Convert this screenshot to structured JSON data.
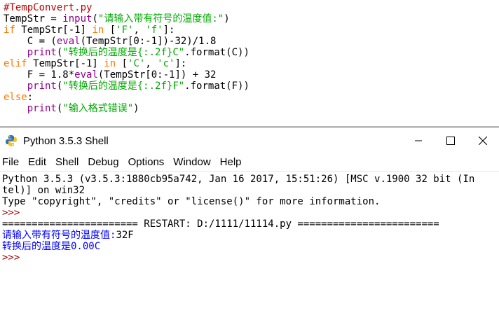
{
  "colors": {
    "comment": "#c00000",
    "keyword": "#ff7700",
    "builtin": "#900090",
    "string": "#00aa00",
    "default": "#000000",
    "stdout": "#0000ff",
    "prompt": "#990000"
  },
  "editor": {
    "lines": [
      [
        {
          "t": "#TempConvert.py",
          "c": "comment"
        }
      ],
      [
        {
          "t": "TempStr = ",
          "c": "default"
        },
        {
          "t": "input",
          "c": "builtin"
        },
        {
          "t": "(",
          "c": "default"
        },
        {
          "t": "\"请输入带有符号的温度值:\"",
          "c": "string"
        },
        {
          "t": ")",
          "c": "default"
        }
      ],
      [
        {
          "t": "if",
          "c": "keyword"
        },
        {
          "t": " TempStr[-1] ",
          "c": "default"
        },
        {
          "t": "in",
          "c": "keyword"
        },
        {
          "t": " [",
          "c": "default"
        },
        {
          "t": "'F'",
          "c": "string"
        },
        {
          "t": ", ",
          "c": "default"
        },
        {
          "t": "'f'",
          "c": "string"
        },
        {
          "t": "]:",
          "c": "default"
        }
      ],
      [
        {
          "t": "    C = (",
          "c": "default"
        },
        {
          "t": "eval",
          "c": "builtin"
        },
        {
          "t": "(TempStr[0:-1])-32)/1.8",
          "c": "default"
        }
      ],
      [
        {
          "t": "    ",
          "c": "default"
        },
        {
          "t": "print",
          "c": "builtin"
        },
        {
          "t": "(",
          "c": "default"
        },
        {
          "t": "\"转换后的温度是{:.2f}C\"",
          "c": "string"
        },
        {
          "t": ".format(C))",
          "c": "default"
        }
      ],
      [
        {
          "t": "elif",
          "c": "keyword"
        },
        {
          "t": " TempStr[-1] ",
          "c": "default"
        },
        {
          "t": "in",
          "c": "keyword"
        },
        {
          "t": " [",
          "c": "default"
        },
        {
          "t": "'C'",
          "c": "string"
        },
        {
          "t": ", ",
          "c": "default"
        },
        {
          "t": "'c'",
          "c": "string"
        },
        {
          "t": "]:",
          "c": "default"
        }
      ],
      [
        {
          "t": "    F = 1.8*",
          "c": "default"
        },
        {
          "t": "eval",
          "c": "builtin"
        },
        {
          "t": "(TempStr[0:-1]) + 32",
          "c": "default"
        }
      ],
      [
        {
          "t": "    ",
          "c": "default"
        },
        {
          "t": "print",
          "c": "builtin"
        },
        {
          "t": "(",
          "c": "default"
        },
        {
          "t": "\"转换后的温度是{:.2f}F\"",
          "c": "string"
        },
        {
          "t": ".format(F))",
          "c": "default"
        }
      ],
      [
        {
          "t": "else",
          "c": "keyword"
        },
        {
          "t": ":",
          "c": "default"
        }
      ],
      [
        {
          "t": "    ",
          "c": "default"
        },
        {
          "t": "print",
          "c": "builtin"
        },
        {
          "t": "(",
          "c": "default"
        },
        {
          "t": "\"输入格式错误\"",
          "c": "string"
        },
        {
          "t": ")",
          "c": "default"
        }
      ]
    ]
  },
  "shell_window": {
    "title": "Python 3.5.3 Shell",
    "app_icon": "python-icon",
    "controls": [
      "minimize-icon",
      "maximize-icon",
      "close-icon"
    ]
  },
  "menu": {
    "items": [
      "File",
      "Edit",
      "Shell",
      "Debug",
      "Options",
      "Window",
      "Help"
    ]
  },
  "shell": {
    "lines": [
      [
        {
          "t": "Python 3.5.3 (v3.5.3:1880cb95a742, Jan 16 2017, 15:51:26) [MSC v.1900 32 bit (In",
          "c": "default"
        }
      ],
      [
        {
          "t": "tel)] on win32",
          "c": "default"
        }
      ],
      [
        {
          "t": "Type \"copyright\", \"credits\" or \"license()\" for more information.",
          "c": "default"
        }
      ],
      [
        {
          "t": ">>> ",
          "c": "prompt"
        }
      ],
      [
        {
          "t": "======================= RESTART: D:/1111/11114.py ========================",
          "c": "default"
        }
      ],
      [
        {
          "t": "请输入带有符号的温度值:",
          "c": "stdout"
        },
        {
          "t": "32F",
          "c": "default"
        }
      ],
      [
        {
          "t": "转换后的温度是0.00C",
          "c": "stdout"
        }
      ],
      [
        {
          "t": ">>> ",
          "c": "prompt"
        }
      ]
    ]
  }
}
